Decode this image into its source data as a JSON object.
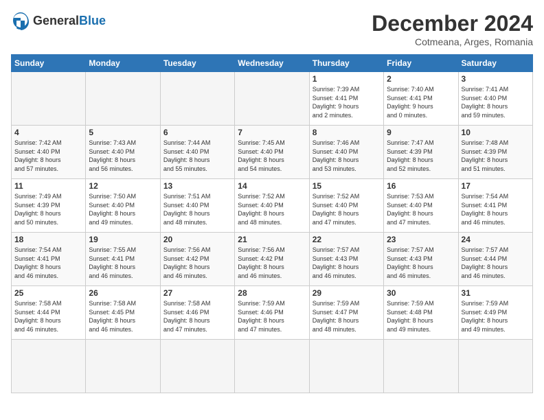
{
  "logo": {
    "general": "General",
    "blue": "Blue"
  },
  "header": {
    "title": "December 2024",
    "subtitle": "Cotmeana, Arges, Romania"
  },
  "weekdays": [
    "Sunday",
    "Monday",
    "Tuesday",
    "Wednesday",
    "Thursday",
    "Friday",
    "Saturday"
  ],
  "days": [
    {
      "num": "",
      "info": ""
    },
    {
      "num": "",
      "info": ""
    },
    {
      "num": "",
      "info": ""
    },
    {
      "num": "",
      "info": ""
    },
    {
      "num": "1",
      "info": "Sunrise: 7:39 AM\nSunset: 4:41 PM\nDaylight: 9 hours\nand 2 minutes."
    },
    {
      "num": "2",
      "info": "Sunrise: 7:40 AM\nSunset: 4:41 PM\nDaylight: 9 hours\nand 0 minutes."
    },
    {
      "num": "3",
      "info": "Sunrise: 7:41 AM\nSunset: 4:40 PM\nDaylight: 8 hours\nand 59 minutes."
    },
    {
      "num": "4",
      "info": "Sunrise: 7:42 AM\nSunset: 4:40 PM\nDaylight: 8 hours\nand 57 minutes."
    },
    {
      "num": "5",
      "info": "Sunrise: 7:43 AM\nSunset: 4:40 PM\nDaylight: 8 hours\nand 56 minutes."
    },
    {
      "num": "6",
      "info": "Sunrise: 7:44 AM\nSunset: 4:40 PM\nDaylight: 8 hours\nand 55 minutes."
    },
    {
      "num": "7",
      "info": "Sunrise: 7:45 AM\nSunset: 4:40 PM\nDaylight: 8 hours\nand 54 minutes."
    },
    {
      "num": "8",
      "info": "Sunrise: 7:46 AM\nSunset: 4:40 PM\nDaylight: 8 hours\nand 53 minutes."
    },
    {
      "num": "9",
      "info": "Sunrise: 7:47 AM\nSunset: 4:39 PM\nDaylight: 8 hours\nand 52 minutes."
    },
    {
      "num": "10",
      "info": "Sunrise: 7:48 AM\nSunset: 4:39 PM\nDaylight: 8 hours\nand 51 minutes."
    },
    {
      "num": "11",
      "info": "Sunrise: 7:49 AM\nSunset: 4:39 PM\nDaylight: 8 hours\nand 50 minutes."
    },
    {
      "num": "12",
      "info": "Sunrise: 7:50 AM\nSunset: 4:40 PM\nDaylight: 8 hours\nand 49 minutes."
    },
    {
      "num": "13",
      "info": "Sunrise: 7:51 AM\nSunset: 4:40 PM\nDaylight: 8 hours\nand 48 minutes."
    },
    {
      "num": "14",
      "info": "Sunrise: 7:52 AM\nSunset: 4:40 PM\nDaylight: 8 hours\nand 48 minutes."
    },
    {
      "num": "15",
      "info": "Sunrise: 7:52 AM\nSunset: 4:40 PM\nDaylight: 8 hours\nand 47 minutes."
    },
    {
      "num": "16",
      "info": "Sunrise: 7:53 AM\nSunset: 4:40 PM\nDaylight: 8 hours\nand 47 minutes."
    },
    {
      "num": "17",
      "info": "Sunrise: 7:54 AM\nSunset: 4:41 PM\nDaylight: 8 hours\nand 46 minutes."
    },
    {
      "num": "18",
      "info": "Sunrise: 7:54 AM\nSunset: 4:41 PM\nDaylight: 8 hours\nand 46 minutes."
    },
    {
      "num": "19",
      "info": "Sunrise: 7:55 AM\nSunset: 4:41 PM\nDaylight: 8 hours\nand 46 minutes."
    },
    {
      "num": "20",
      "info": "Sunrise: 7:56 AM\nSunset: 4:42 PM\nDaylight: 8 hours\nand 46 minutes."
    },
    {
      "num": "21",
      "info": "Sunrise: 7:56 AM\nSunset: 4:42 PM\nDaylight: 8 hours\nand 46 minutes."
    },
    {
      "num": "22",
      "info": "Sunrise: 7:57 AM\nSunset: 4:43 PM\nDaylight: 8 hours\nand 46 minutes."
    },
    {
      "num": "23",
      "info": "Sunrise: 7:57 AM\nSunset: 4:43 PM\nDaylight: 8 hours\nand 46 minutes."
    },
    {
      "num": "24",
      "info": "Sunrise: 7:57 AM\nSunset: 4:44 PM\nDaylight: 8 hours\nand 46 minutes."
    },
    {
      "num": "25",
      "info": "Sunrise: 7:58 AM\nSunset: 4:44 PM\nDaylight: 8 hours\nand 46 minutes."
    },
    {
      "num": "26",
      "info": "Sunrise: 7:58 AM\nSunset: 4:45 PM\nDaylight: 8 hours\nand 46 minutes."
    },
    {
      "num": "27",
      "info": "Sunrise: 7:58 AM\nSunset: 4:46 PM\nDaylight: 8 hours\nand 47 minutes."
    },
    {
      "num": "28",
      "info": "Sunrise: 7:59 AM\nSunset: 4:46 PM\nDaylight: 8 hours\nand 47 minutes."
    },
    {
      "num": "29",
      "info": "Sunrise: 7:59 AM\nSunset: 4:47 PM\nDaylight: 8 hours\nand 48 minutes."
    },
    {
      "num": "30",
      "info": "Sunrise: 7:59 AM\nSunset: 4:48 PM\nDaylight: 8 hours\nand 49 minutes."
    },
    {
      "num": "31",
      "info": "Sunrise: 7:59 AM\nSunset: 4:49 PM\nDaylight: 8 hours\nand 49 minutes."
    },
    {
      "num": "",
      "info": ""
    },
    {
      "num": "",
      "info": ""
    },
    {
      "num": "",
      "info": ""
    },
    {
      "num": "",
      "info": ""
    }
  ]
}
